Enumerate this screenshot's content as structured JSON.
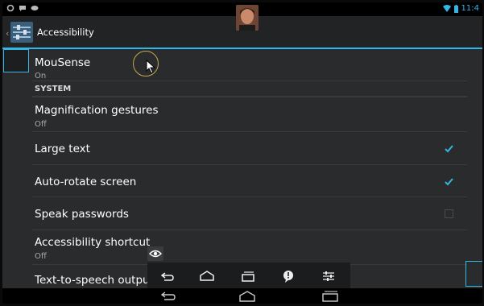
{
  "status_bar": {
    "time": "11:4"
  },
  "action_bar": {
    "title": "Accessibility"
  },
  "mousense": {
    "title": "MouSense",
    "summary": "On"
  },
  "system_header": "SYSTEM",
  "settings": [
    {
      "title": "Magnification gestures",
      "summary": "Off",
      "control": "none"
    },
    {
      "title": "Large text",
      "control": "checkbox",
      "checked": true
    },
    {
      "title": "Auto-rotate screen",
      "control": "checkbox",
      "checked": true
    },
    {
      "title": "Speak passwords",
      "control": "checkbox",
      "checked": false
    },
    {
      "title": "Accessibility shortcut",
      "summary": "Off",
      "control": "none"
    },
    {
      "title": "Text-to-speech output",
      "control": "none"
    }
  ],
  "colors": {
    "accent": "#33b5e5",
    "background": "#2a2b2d",
    "divider": "#3a3b3d"
  }
}
